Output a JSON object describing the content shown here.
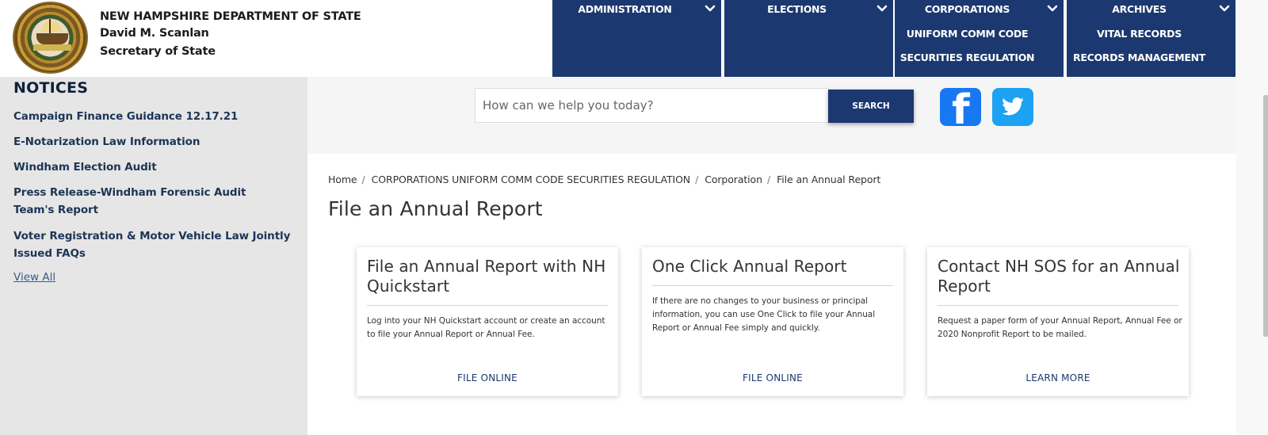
{
  "header": {
    "org_name": "NEW HAMPSHIRE DEPARTMENT OF STATE",
    "official_name": "David M. Scanlan",
    "official_title": "Secretary of State",
    "logo": "nh-state-seal"
  },
  "nav": [
    {
      "label": "ADMINISTRATION",
      "icon": "chevron-down-icon",
      "sub": []
    },
    {
      "label": "ELECTIONS",
      "icon": "chevron-down-icon",
      "sub": []
    },
    {
      "label": "CORPORATIONS",
      "icon": "chevron-down-icon",
      "sub": [
        "UNIFORM COMM CODE",
        "SECURITIES REGULATION"
      ]
    },
    {
      "label": "ARCHIVES",
      "icon": "chevron-down-icon",
      "sub": [
        "VITAL RECORDS",
        "RECORDS MANAGEMENT"
      ]
    }
  ],
  "sidebar": {
    "heading": "NOTICES",
    "notices": [
      "Campaign Finance Guidance 12.17.21",
      "E-Notarization Law Information",
      "Windham Election Audit",
      "Press Release-Windham Forensic Audit Team's Report",
      "Voter Registration & Motor Vehicle Law Jointly Issued FAQs"
    ],
    "view_all": "View All"
  },
  "search": {
    "placeholder": "How can we help you today?",
    "value": "",
    "button_label": "SEARCH"
  },
  "social": {
    "facebook_glyph": "f",
    "facebook_color": "#1877f2",
    "twitter_color": "#1da1f2"
  },
  "breadcrumb": [
    "Home",
    "CORPORATIONS UNIFORM COMM CODE SECURITIES REGULATION",
    "Corporation",
    "File an Annual Report"
  ],
  "breadcrumb_separator": "/",
  "page_title": "File an Annual Report",
  "cards": [
    {
      "title": "File an Annual Report with NH Quickstart",
      "body": "Log into your NH Quickstart account or create an account to file your Annual Report or Annual Fee.",
      "cta": "FILE ONLINE"
    },
    {
      "title": "One Click Annual Report",
      "body": "If there are no changes to your business or principal information, you can use One Click to file your Annual Report or Annual Fee simply and quickly.",
      "cta": "FILE ONLINE"
    },
    {
      "title": "Contact NH SOS for an Annual Report",
      "body": "Request a paper form of your Annual Report, Annual Fee or 2020 Nonprofit Report to be mailed.",
      "cta": "LEARN MORE"
    }
  ],
  "colors": {
    "brand_navy": "#1c3870",
    "sidebar_bg": "#e6e6e6",
    "notice_text": "#1c3556",
    "card_rule": "#e7d3a8"
  }
}
